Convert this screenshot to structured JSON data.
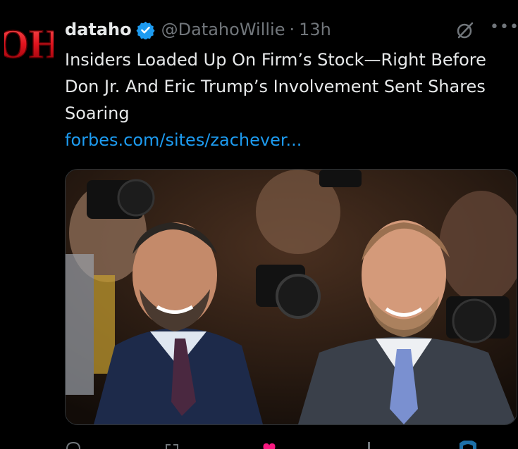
{
  "tweet": {
    "display_name": "dataho",
    "handle": "@DatahoWillie",
    "separator": "·",
    "time": "13h",
    "avatar_text": "OH",
    "text": "Insiders Loaded Up On Firm’s Stock—Right Before Don Jr. And Eric Trump’s Involvement Sent Shares Soaring",
    "link": "forbes.com/sites/zachever..."
  },
  "icons": {
    "verified": "verified-badge-icon",
    "grok": "grok-icon",
    "more": "more-icon",
    "reply": "reply-icon",
    "retweet": "retweet-icon",
    "like": "like-icon",
    "views": "views-icon",
    "share": "share-icon"
  },
  "colors": {
    "background": "#000000",
    "link": "#1d9bf0",
    "verified": "#1d9bf0",
    "muted": "#71767b",
    "avatar": "#e0141e",
    "like": "#f91880"
  }
}
